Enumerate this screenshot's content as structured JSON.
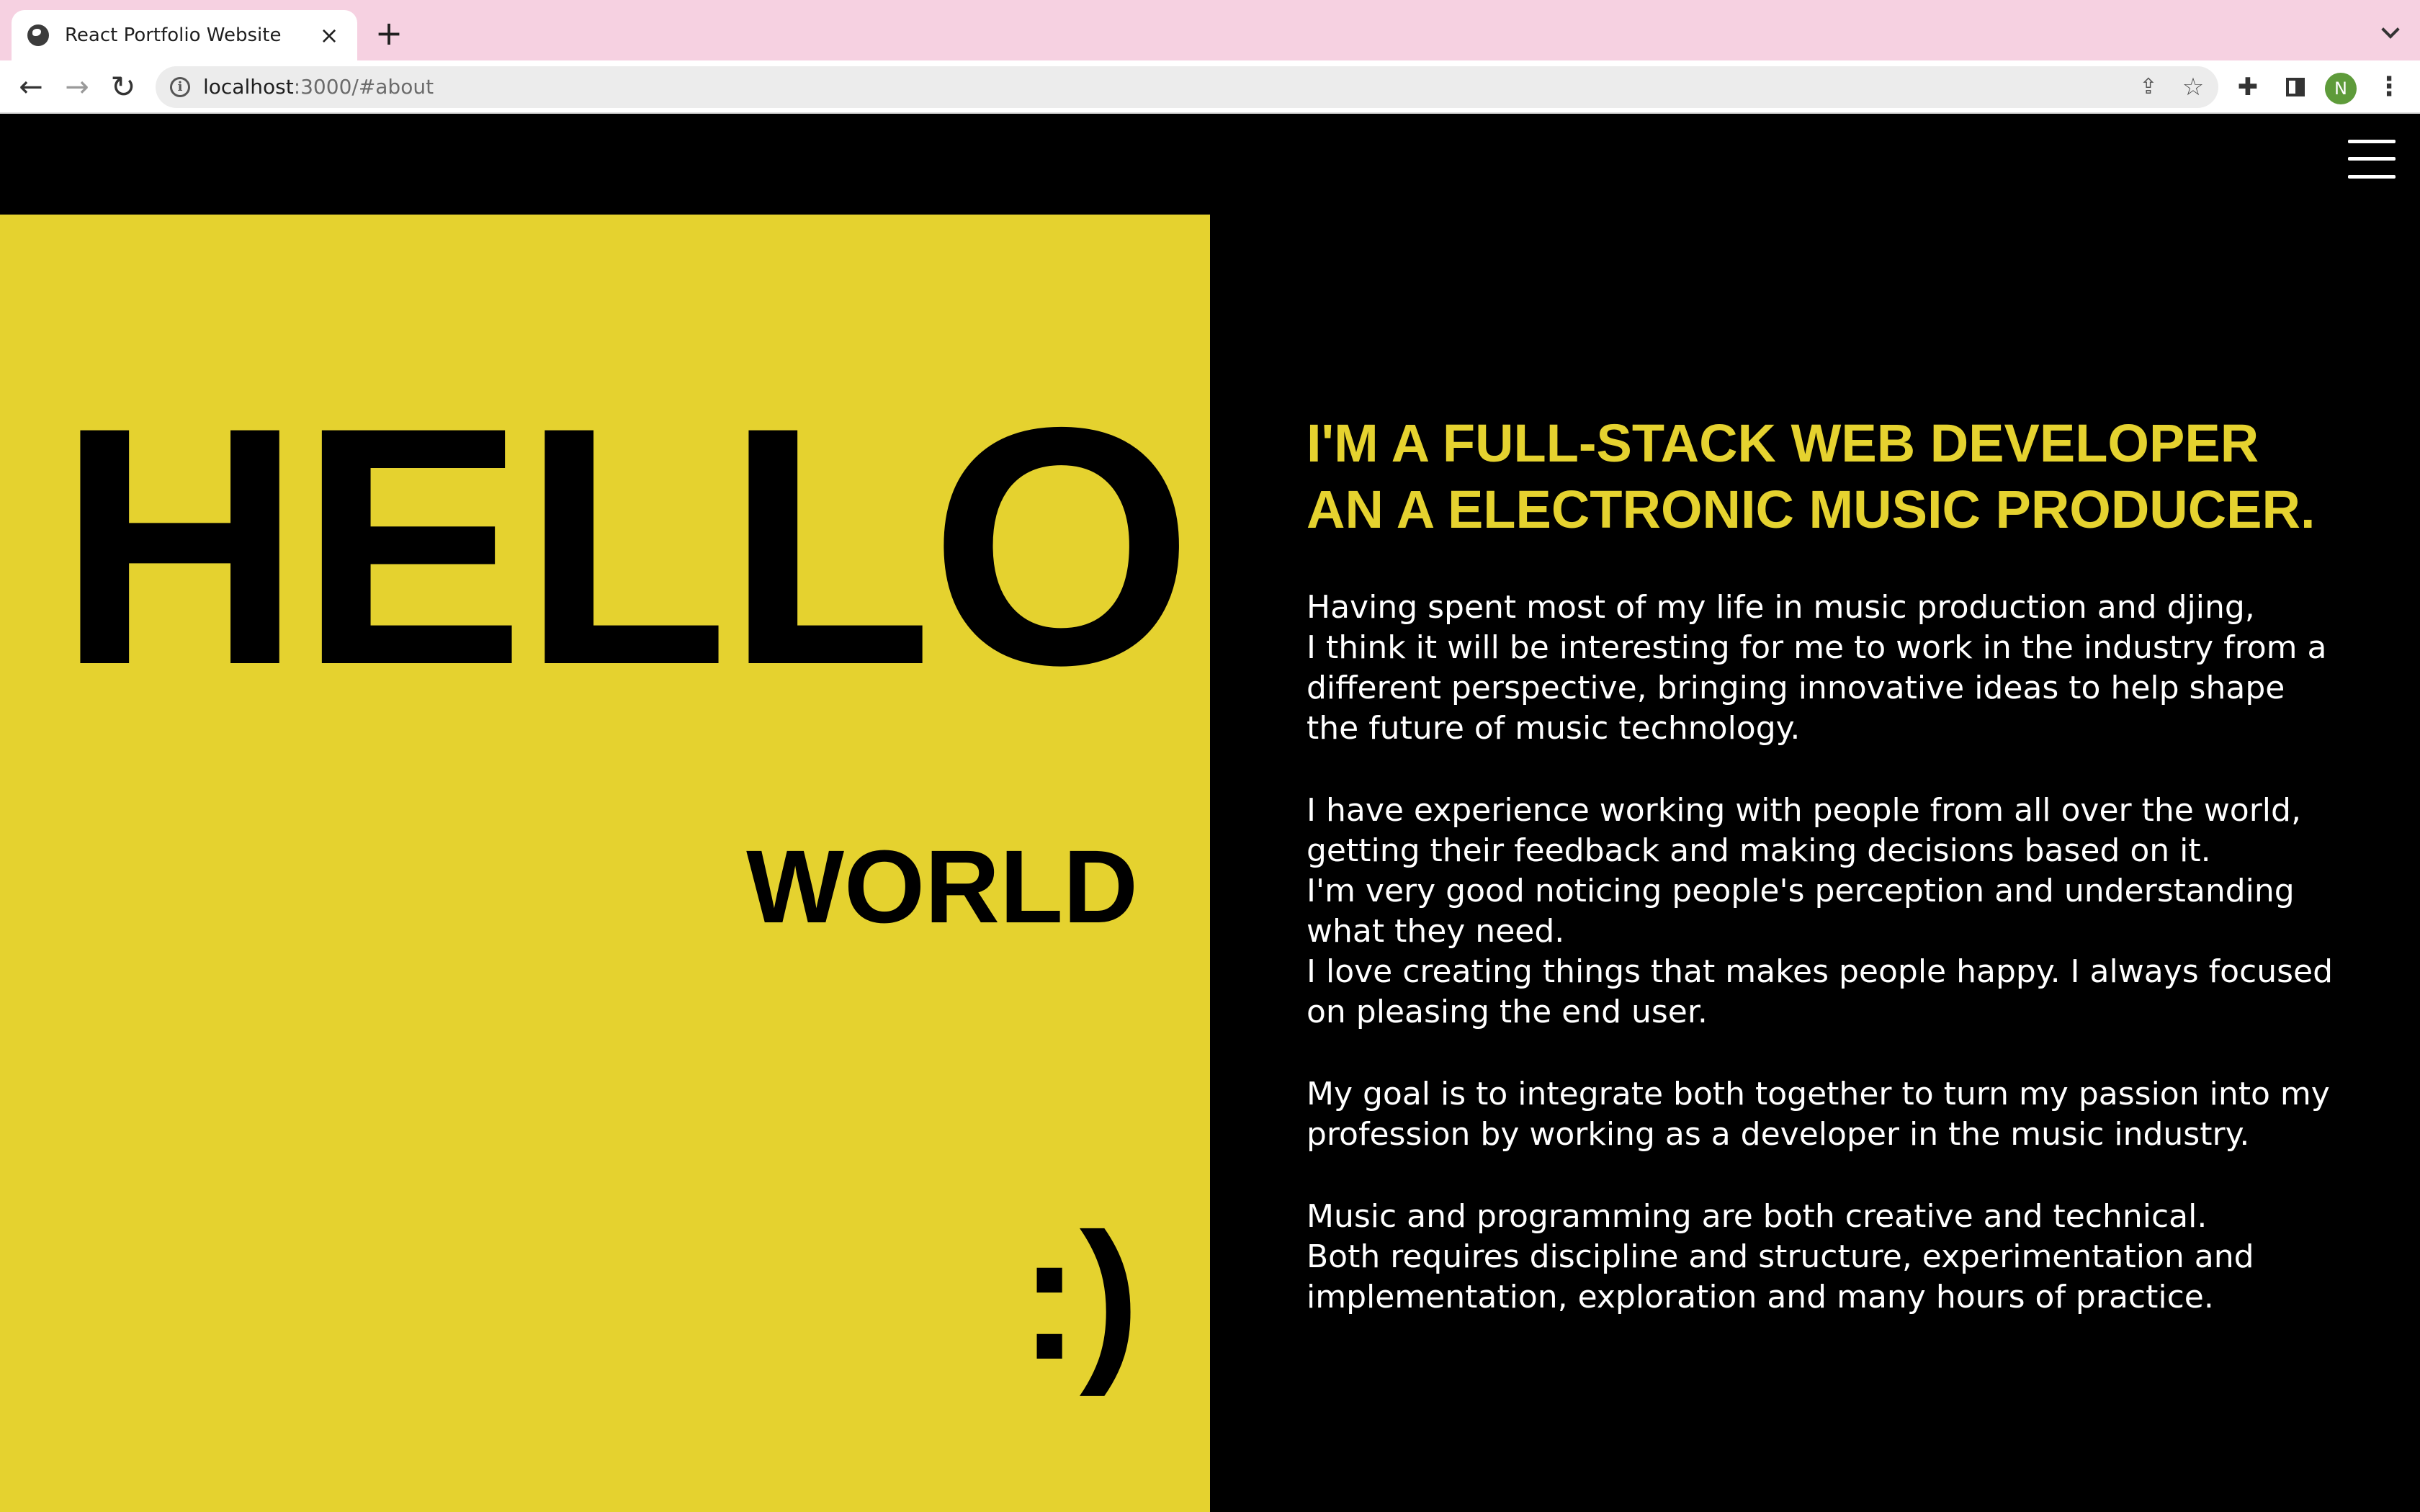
{
  "browser": {
    "tab_title": "React Portfolio Website",
    "tab_close": "×",
    "new_tab": "+",
    "url_host": "localhost",
    "url_path": ":3000/#about",
    "avatar_letter": "N",
    "avatar_color": "#5e9b3a",
    "tabstrip_color": "#f6d1e1"
  },
  "page": {
    "accent_color": "#e5d22f",
    "hello": "HELLO",
    "world": "WORLD",
    "smile": ":)",
    "headline": [
      "I'M A FULL-STACK WEB DEVELOPER",
      "AN A ELECTRONIC MUSIC PRODUCER."
    ],
    "paragraphs": [
      [
        "Having spent most of my life in music production and djing,",
        "I think it will be interesting for me to work in the industry from a",
        "different perspective, bringing innovative ideas to help shape",
        "the future of music technology."
      ],
      [
        "I have experience working with people from all over the world,",
        "getting their feedback and making decisions based on it.",
        "I'm very good noticing people's perception and understanding",
        "what they need.",
        "I love creating things that makes people happy. I always focused",
        "on pleasing the end user."
      ],
      [
        "My goal is to integrate both together to turn my passion into my",
        "profession by working as a developer in the music industry."
      ],
      [
        "Music and programming are both creative and technical.",
        "Both requires discipline and structure, experimentation and",
        "implementation, exploration and many hours of practice."
      ]
    ]
  }
}
